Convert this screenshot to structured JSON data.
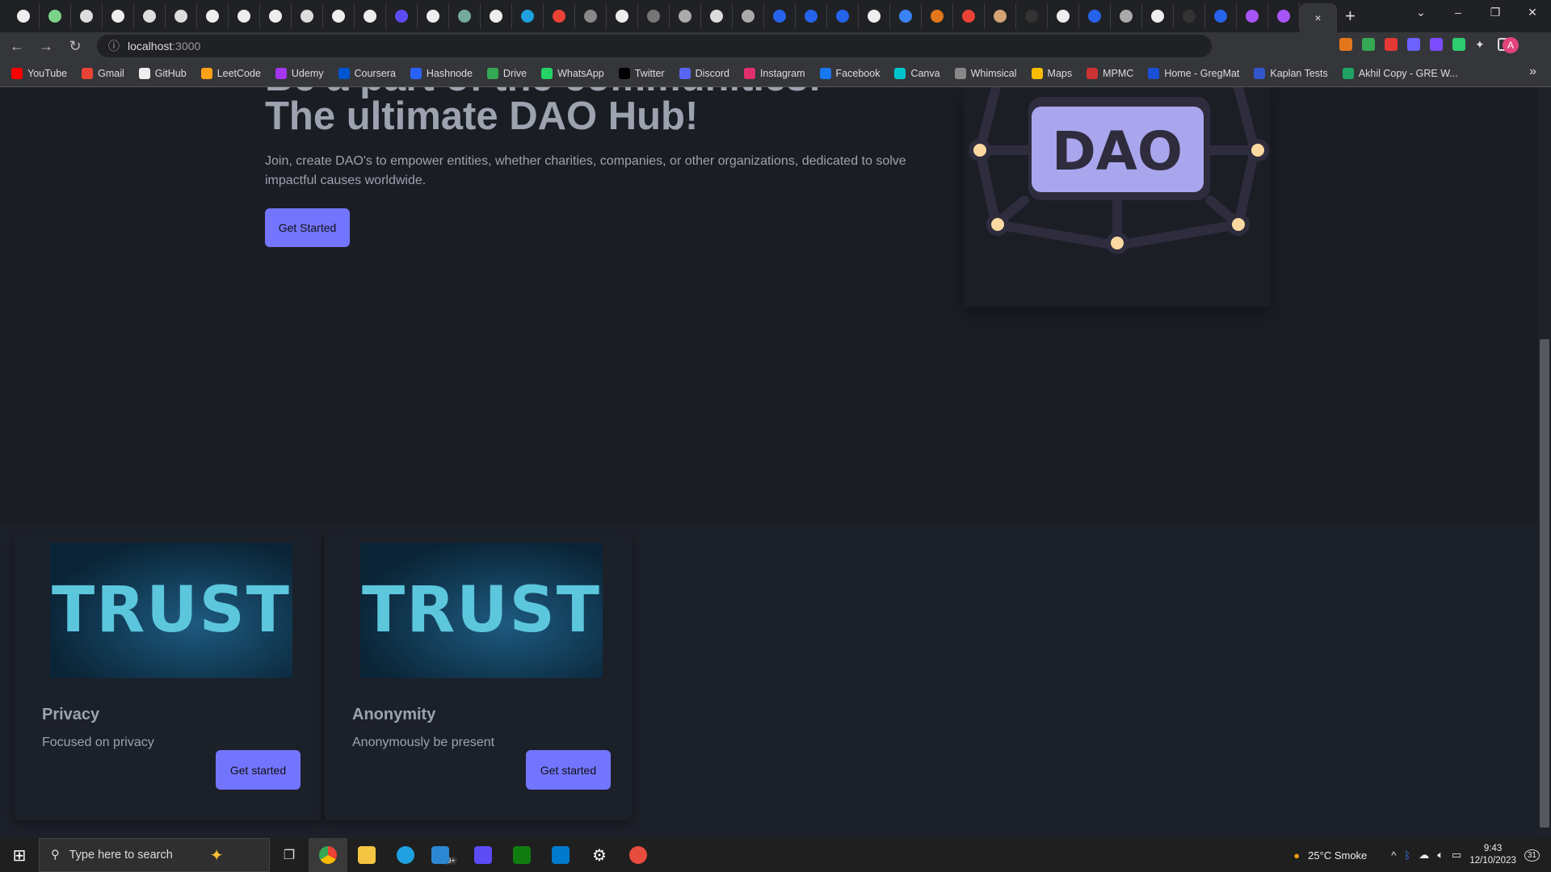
{
  "browser": {
    "tab_count": 41,
    "active_tab_close": "×",
    "new_tab": "+",
    "url_host": "localhost",
    "url_port": ":3000",
    "profile_initial": "A",
    "bookmarks": [
      {
        "label": "YouTube",
        "color": "#ff0000"
      },
      {
        "label": "Gmail",
        "color": "#ea4335"
      },
      {
        "label": "GitHub",
        "color": "#eeeeee"
      },
      {
        "label": "LeetCode",
        "color": "#ffa116"
      },
      {
        "label": "Udemy",
        "color": "#a435f0"
      },
      {
        "label": "Coursera",
        "color": "#0056d2"
      },
      {
        "label": "Hashnode",
        "color": "#2962ff"
      },
      {
        "label": "Drive",
        "color": "#34a853"
      },
      {
        "label": "WhatsApp",
        "color": "#25d366"
      },
      {
        "label": "Twitter",
        "color": "#000000"
      },
      {
        "label": "Discord",
        "color": "#5865f2"
      },
      {
        "label": "Instagram",
        "color": "#e1306c"
      },
      {
        "label": "Facebook",
        "color": "#1877f2"
      },
      {
        "label": "Canva",
        "color": "#00c4cc"
      },
      {
        "label": "Whimsical",
        "color": "#888888"
      },
      {
        "label": "Maps",
        "color": "#fbbc04"
      },
      {
        "label": "MPMC",
        "color": "#cc3333"
      },
      {
        "label": "Home - GregMat",
        "color": "#1a4fd6"
      },
      {
        "label": "Kaplan Tests",
        "color": "#3355cc"
      },
      {
        "label": "Akhil Copy - GRE W...",
        "color": "#1fa463"
      }
    ],
    "bookmarks_more": "»"
  },
  "hero": {
    "title_line1": "Be a part of the communities!",
    "title_line2": "The ultimate DAO Hub!",
    "description": "Join, create DAO's to empower entities, whether charities, companies, or other organizations, dedicated to solve impactful causes worldwide.",
    "cta": "Get Started",
    "image_text": "DAO"
  },
  "cards": [
    {
      "image_text": "TRUST",
      "title": "Privacy",
      "description": "Focused on privacy",
      "button": "Get started"
    },
    {
      "image_text": "TRUST",
      "title": "Anonymity",
      "description": "Anonymously be present",
      "button": "Get started"
    }
  ],
  "taskbar": {
    "search_placeholder": "Type here to search",
    "mail_badge": "99+",
    "weather": "25°C  Smoke",
    "time": "9:43",
    "date": "12/10/2023",
    "notifications": "31"
  },
  "colors": {
    "accent": "#7375ff",
    "page_bg": "#1b1d24",
    "text": "#9ca3af"
  }
}
